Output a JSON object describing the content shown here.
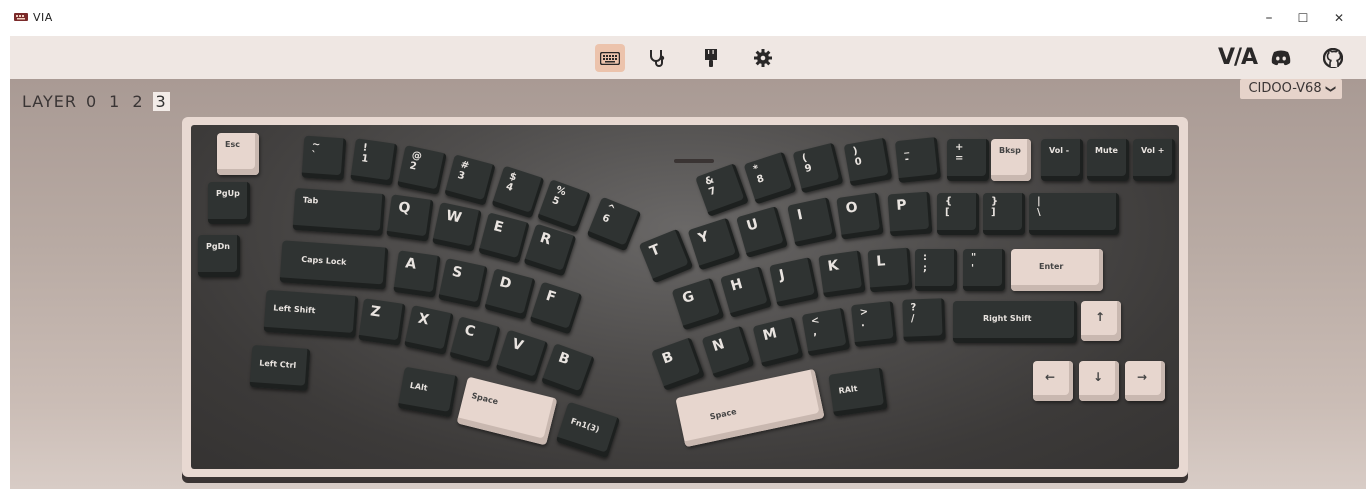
{
  "window": {
    "title": "VIA",
    "minimize": "–",
    "maximize": "☐",
    "close": "✕"
  },
  "toolbar": {
    "icons": [
      "keyboard-icon",
      "stethoscope-icon",
      "brush-icon",
      "gear-icon"
    ],
    "brand": "V/A",
    "right_icons": [
      "discord-icon",
      "github-icon"
    ]
  },
  "layer": {
    "label": "LAYER",
    "numbers": [
      "0",
      "1",
      "2",
      "3"
    ],
    "selected": "3"
  },
  "keyboard_select": {
    "value": "CIDOO-V68",
    "chevron": "❯"
  },
  "colors": {
    "accent": "#ecc3ac",
    "key_dark": "#2f3332",
    "key_light": "#e7d6ce",
    "case": "#e8d9d2"
  },
  "keys": {
    "esc": "Esc",
    "pgup": "PgUp",
    "pgdn": "PgDn",
    "tilde": "~\n`",
    "k1": "!\n1",
    "k2": "@\n2",
    "k3": "#\n3",
    "k4": "$\n4",
    "k5": "%\n5",
    "k6": "^\n6",
    "k7": "&\n7",
    "k8": "*\n8",
    "k9": "(\n9",
    "k0": ")\n0",
    "minus": "_\n-",
    "equal": "+\n=",
    "bksp": "Bksp",
    "vold": "Vol -",
    "mute": "Mute",
    "volu": "Vol +",
    "tab": "Tab",
    "q": "Q",
    "w": "W",
    "e": "E",
    "r": "R",
    "t": "T",
    "y": "Y",
    "u": "U",
    "i": "I",
    "o": "O",
    "p": "P",
    "lbracket": "{\n[",
    "rbracket": "}\n]",
    "backslash": "|\n\\",
    "caps": "Caps Lock",
    "a": "A",
    "s": "S",
    "d": "D",
    "f": "F",
    "g": "G",
    "h": "H",
    "j": "J",
    "k": "K",
    "l": "L",
    "semicolon": ":\n;",
    "quote": "\"\n'",
    "enter": "Enter",
    "lshift": "Left Shift",
    "z": "Z",
    "x": "X",
    "c": "C",
    "v": "V",
    "b1": "B",
    "b2": "B",
    "n": "N",
    "m": "M",
    "comma": "<\n,",
    "period": ">\n.",
    "slash": "?\n/",
    "rshift": "Right Shift",
    "up": "↑",
    "lctrl": "Left Ctrl",
    "lalt": "LAlt",
    "space1": "Space",
    "fn": "Fn1(3)",
    "space2": "Space",
    "ralt": "RAlt",
    "left": "←",
    "down": "↓",
    "right": "→"
  }
}
